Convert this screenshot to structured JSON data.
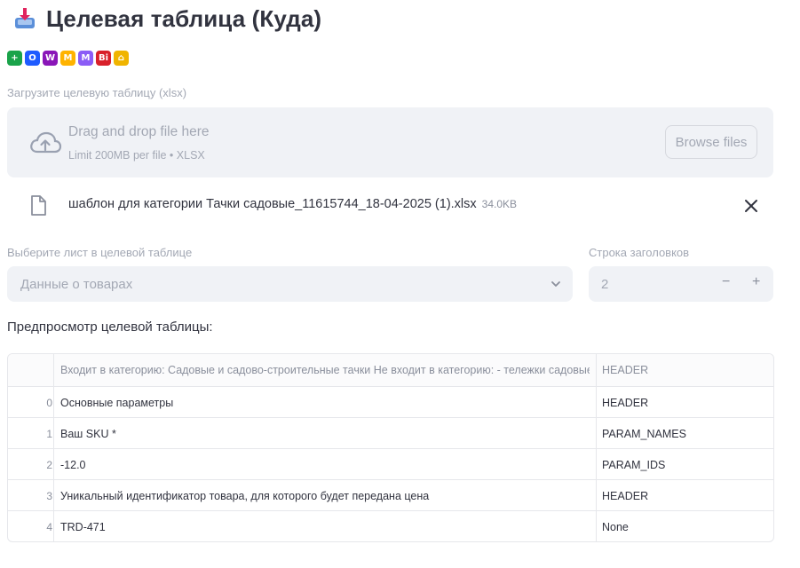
{
  "header": {
    "title": "Целевая таблица (Куда)",
    "title_icon": "inbox-tray-icon"
  },
  "marketplace_icons": [
    {
      "name": "plus-green-icon",
      "color": "#1aa34a",
      "glyph": "+"
    },
    {
      "name": "ozon-icon",
      "color": "#1e5bff",
      "glyph": "O"
    },
    {
      "name": "wildberries-icon",
      "color": "#8a16b8",
      "glyph": "W"
    },
    {
      "name": "yandex-market-icon",
      "color": "#ffb300",
      "glyph": "M"
    },
    {
      "name": "megamarket-icon",
      "color": "#8b5cf6",
      "glyph": "M"
    },
    {
      "name": "vi-icon",
      "color": "#d8202a",
      "glyph": "Ві"
    },
    {
      "name": "house-icon",
      "color": "#f0b400",
      "glyph": "⌂"
    }
  ],
  "uploader": {
    "label": "Загрузите целевую таблицу (xlsx)",
    "drop_title": "Drag and drop file here",
    "drop_limit": "Limit 200MB per file • XLSX",
    "browse_label": "Browse files"
  },
  "uploaded_file": {
    "name": "шаблон для категории Тачки садовые_11615744_18-04-2025 (1).xlsx",
    "size": "34.0KB"
  },
  "sheet_select": {
    "label": "Выберите лист в целевой таблице",
    "value": "Данные о товарах"
  },
  "header_row": {
    "label": "Строка заголовков",
    "value": "2",
    "minus": "−",
    "plus": "+"
  },
  "preview": {
    "title": "Предпросмотр целевой таблицы:",
    "columns": [
      "Входит в категорию: Садовые и садово-строительные тачки  Не входит в категорию: - тележки садовые",
      "HEADER"
    ],
    "rows": [
      {
        "index": "0",
        "a": "Основные параметры",
        "b": "HEADER"
      },
      {
        "index": "1",
        "a": "Ваш SKU *",
        "b": "PARAM_NAMES"
      },
      {
        "index": "2",
        "a": "-12.0",
        "b": "PARAM_IDS"
      },
      {
        "index": "3",
        "a": "Уникальный идентификатор товара, для которого будет передана цена",
        "b": "HEADER"
      },
      {
        "index": "4",
        "a": "TRD-471",
        "b": "None"
      }
    ]
  }
}
